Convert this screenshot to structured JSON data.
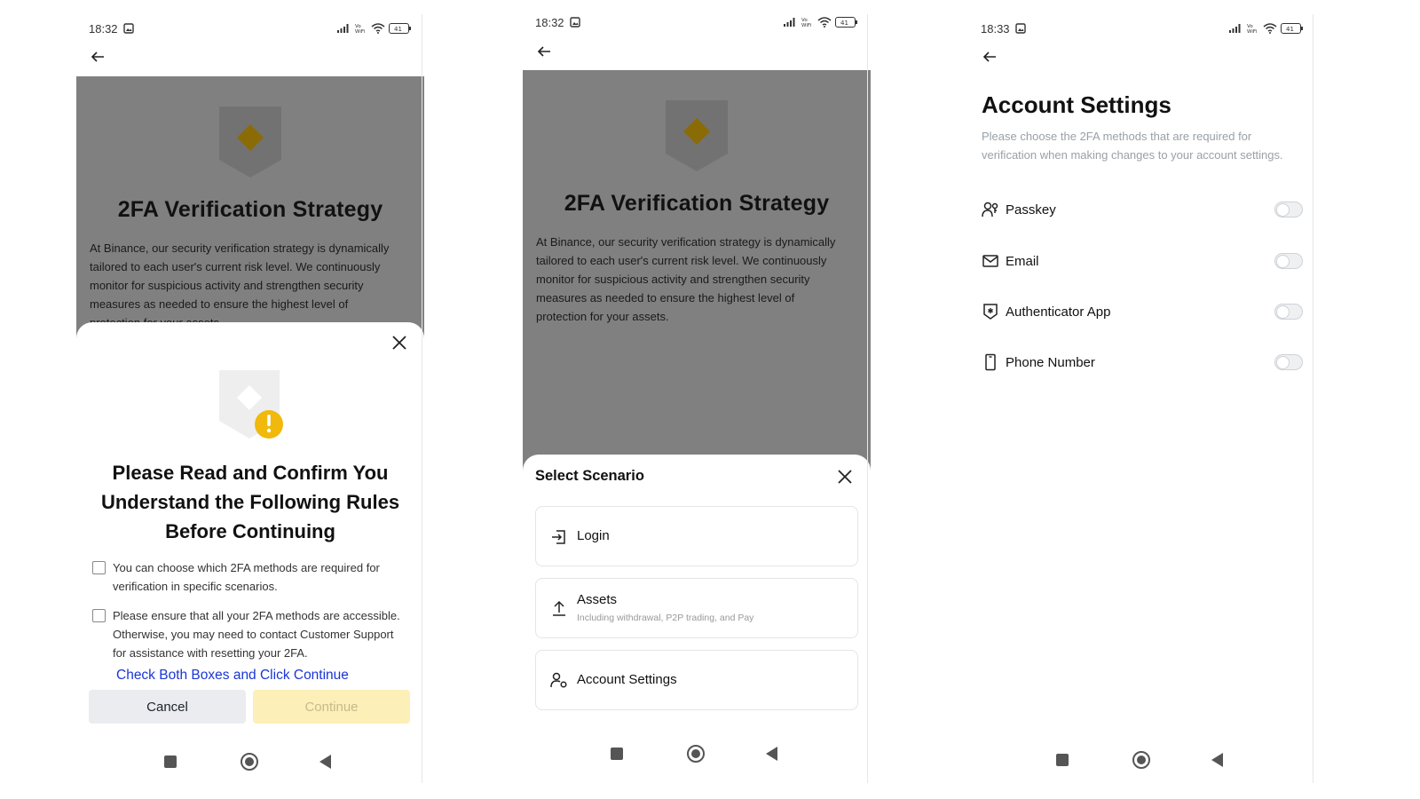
{
  "screen1": {
    "status": {
      "time": "18:32",
      "battery": "41"
    },
    "strategy": {
      "title": "2FA Verification Strategy",
      "text": "At Binance, our security verification strategy is dynamically tailored to each user's current risk level. We continuously monitor for suspicious activity and strengthen security measures as needed to ensure the highest level of protection for your assets."
    },
    "sheet": {
      "title": "Please Read and Confirm You Understand the Following Rules Before Continuing",
      "rules": [
        "You can choose which 2FA methods are required for verification in specific scenarios.",
        "Please ensure that all your 2FA methods are accessible. Otherwise, you may need to contact Customer Support for assistance with resetting your 2FA."
      ],
      "hint": "Check Both Boxes and Click Continue",
      "cancel_label": "Cancel",
      "continue_label": "Continue"
    }
  },
  "screen2": {
    "status": {
      "time": "18:32",
      "battery": "41"
    },
    "strategy": {
      "title": "2FA Verification Strategy",
      "text": "At Binance, our security verification strategy is dynamically tailored to each user's current risk level. We continuously monitor for suspicious activity and strengthen security measures as needed to ensure the highest level of protection for your assets."
    },
    "sheet": {
      "title": "Select Scenario",
      "options": [
        {
          "label": "Login",
          "sub": "",
          "icon": "login-icon"
        },
        {
          "label": "Assets",
          "sub": "Including withdrawal, P2P trading, and Pay",
          "icon": "upload-icon"
        },
        {
          "label": "Account Settings",
          "sub": "",
          "icon": "user-settings-icon"
        }
      ]
    }
  },
  "screen3": {
    "status": {
      "time": "18:33",
      "battery": "41"
    },
    "title": "Account Settings",
    "description": "Please choose the 2FA methods that are required for verification when making changes to your account settings.",
    "methods": [
      {
        "label": "Passkey",
        "icon": "passkey-icon",
        "enabled": false
      },
      {
        "label": "Email",
        "icon": "email-icon",
        "enabled": false
      },
      {
        "label": "Authenticator App",
        "icon": "authenticator-icon",
        "enabled": false
      },
      {
        "label": "Phone Number",
        "icon": "phone-icon",
        "enabled": false
      }
    ]
  },
  "colors": {
    "brand_yellow": "#F0B90B",
    "overlay_gray": "#808080",
    "hint_blue": "#1A35D8"
  }
}
